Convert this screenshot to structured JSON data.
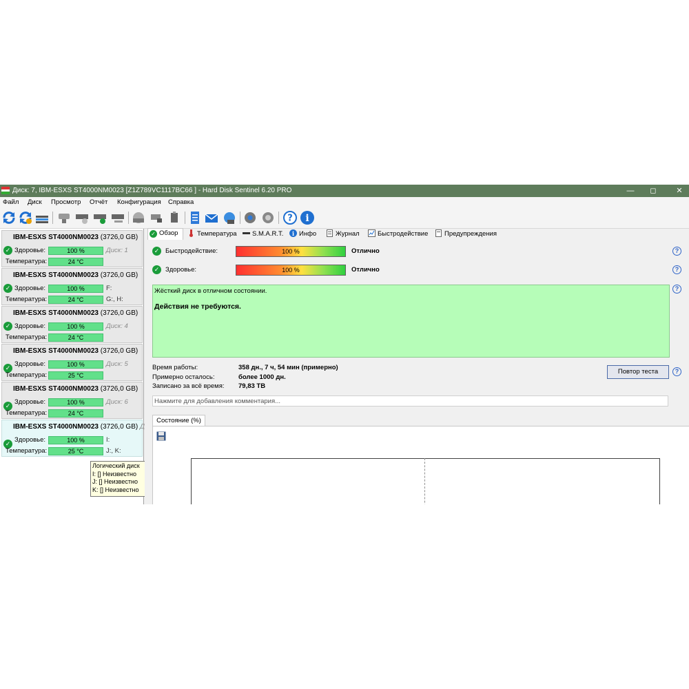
{
  "window": {
    "title": "Диск: 7, IBM-ESXS ST4000NM0023 [Z1Z789VC1117BC66   ]  -  Hard Disk Sentinel 6.20 PRO",
    "controls": [
      "—",
      "◻",
      "✕"
    ]
  },
  "menu": [
    "Файл",
    "Диск",
    "Просмотр",
    "Отчёт",
    "Конфигурация",
    "Справка"
  ],
  "toolbar": {
    "icons": [
      "refresh-icon",
      "refresh-all-icon",
      "warning-icon",
      "disk-info-icon",
      "hdd-icon",
      "disk-test-icon",
      "disk-ok-icon",
      "disk-settings-icon",
      "cd-drive-icon",
      "network-drive-icon",
      "usb-drive-icon",
      "report-icon",
      "email-icon",
      "network-icon",
      "settings-icon",
      "sound-icon",
      "help-icon",
      "info-icon"
    ]
  },
  "disks": [
    {
      "name": "IBM-ESXS ST4000NM0023",
      "size": "(3726,0 GB)",
      "health_label": "Здоровье:",
      "health": "100 %",
      "temp_label": "Температура:",
      "temp": "24 °C",
      "drive1": "Диск: 1",
      "drive2": ""
    },
    {
      "name": "IBM-ESXS ST4000NM0023",
      "size": "(3726,0 GB)",
      "health_label": "Здоровье:",
      "health": "100 %",
      "temp_label": "Температура:",
      "temp": "24 °C",
      "drive1": "F:",
      "drive2": "G:, H:"
    },
    {
      "name": "IBM-ESXS ST4000NM0023",
      "size": "(3726,0 GB)",
      "health_label": "Здоровье:",
      "health": "100 %",
      "temp_label": "Температура:",
      "temp": "24 °C",
      "drive1": "Диск: 4",
      "drive2": ""
    },
    {
      "name": "IBM-ESXS ST4000NM0023",
      "size": "(3726,0 GB)",
      "health_label": "Здоровье:",
      "health": "100 %",
      "temp_label": "Температура:",
      "temp": "25 °C",
      "drive1": "Диск: 5",
      "drive2": ""
    },
    {
      "name": "IBM-ESXS ST4000NM0023",
      "size": "(3726,0 GB)",
      "health_label": "Здоровье:",
      "health": "100 %",
      "temp_label": "Температура:",
      "temp": "24 °C",
      "drive1": "Диск: 6",
      "drive2": ""
    },
    {
      "name": "IBM-ESXS ST4000NM0023",
      "size": "(3726,0 GB)",
      "health_label": "Здоровье:",
      "health": "100 %",
      "temp_label": "Температура:",
      "temp": "25 °C",
      "drive1": "I:",
      "drive2": "J:, K:",
      "extra": "Диск"
    }
  ],
  "tooltip": {
    "title": "Логический диск",
    "lines": [
      "I: [] Неизвестно",
      "J: [] Неизвестно",
      "K: [] Неизвестно"
    ]
  },
  "tabs": [
    "Обзор",
    "Температура",
    "S.M.A.R.T.",
    "Инфо",
    "Журнал",
    "Быстродействие",
    "Предупреждения"
  ],
  "overview": {
    "performance_label": "Быстродействие:",
    "performance_value": "100 %",
    "performance_percent": 100,
    "performance_rating": "Отлично",
    "health_label": "Здоровье:",
    "health_value": "100 %",
    "health_percent": 100,
    "health_rating": "Отлично",
    "status_line1": "Жёсткий диск в отличном состоянии.",
    "status_line2": "Действия не требуются.",
    "uptime_label": "Время работы:",
    "uptime_value": "358 дн., 7 ч, 54 мин (примерно)",
    "remaining_label": "Примерно осталось:",
    "remaining_value": "более 1000 дн.",
    "written_label": "Записано за всё время:",
    "written_value": "79,83 TB",
    "retest_button": "Повтор теста",
    "comment_placeholder": "Нажмите для добавления комментария...",
    "subtab": "Состояние (%)",
    "help": "?"
  },
  "colors": {
    "titlebar": "#5e7c5b",
    "health_bar": "#62e08a",
    "status_box": "#b6fdb8",
    "check": "#1a9c3a"
  }
}
